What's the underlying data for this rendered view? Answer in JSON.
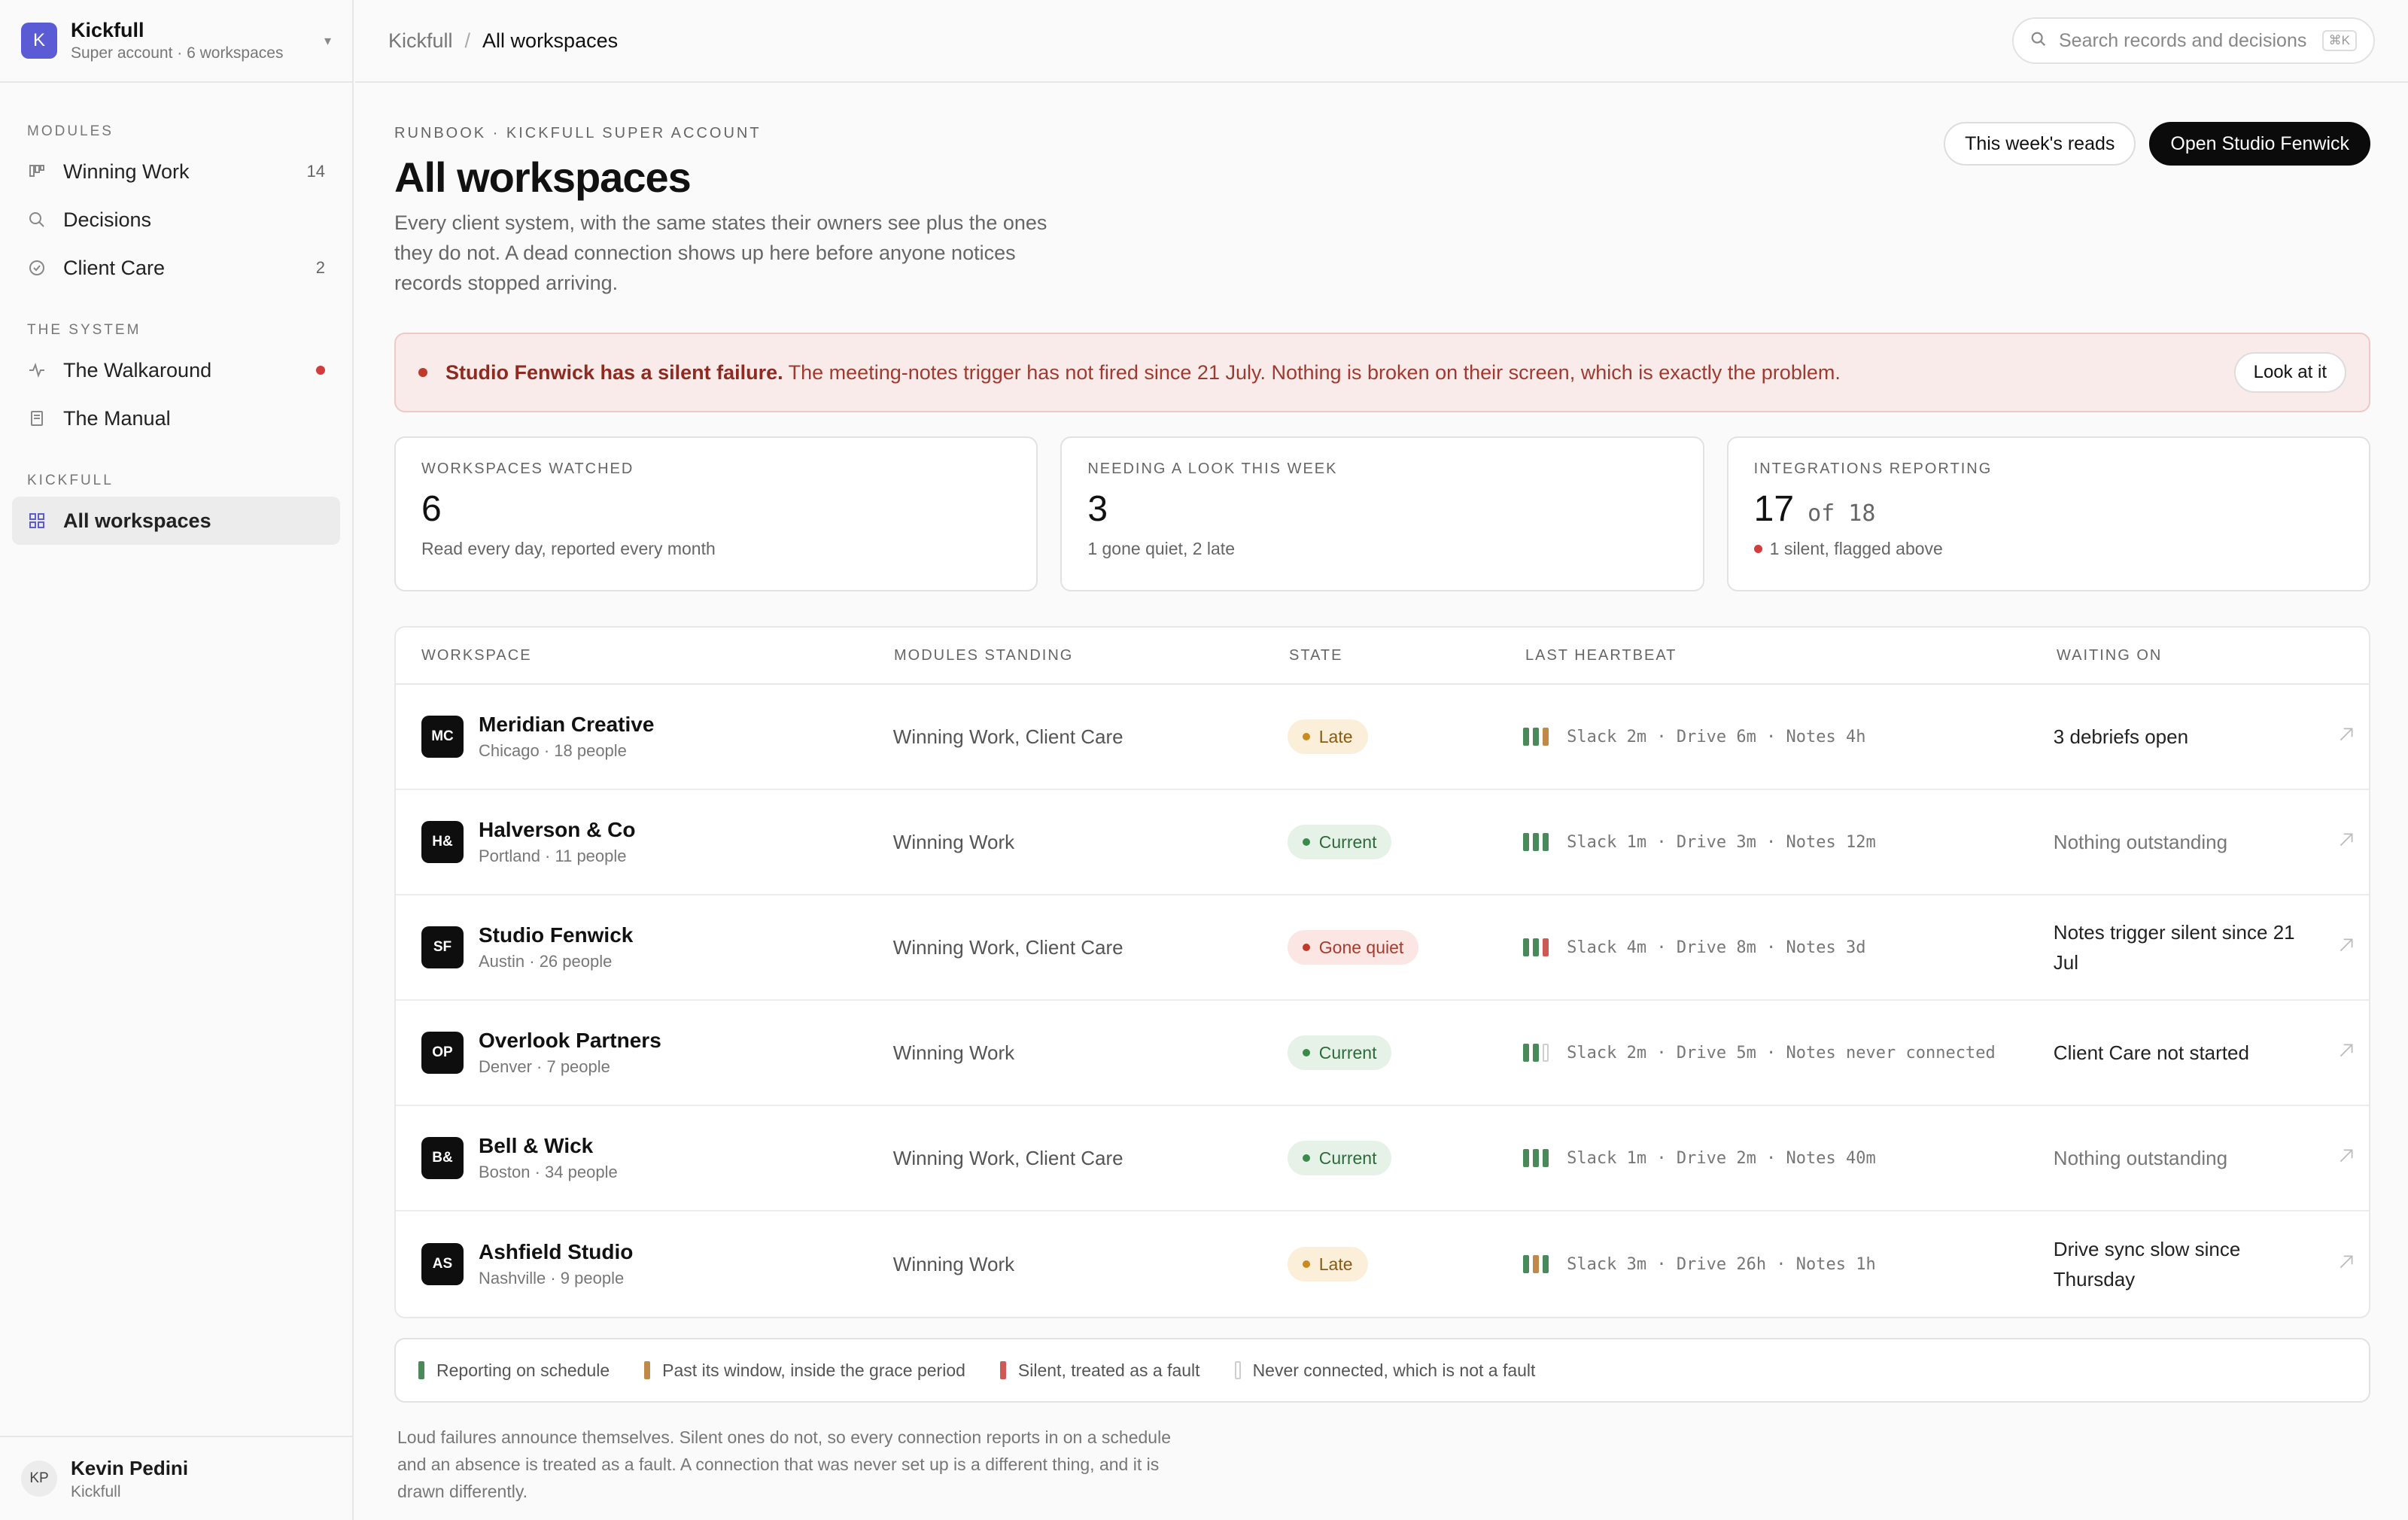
{
  "workspace": {
    "logo": "K",
    "name": "Kickfull",
    "subtitle": "Super account · 6 workspaces"
  },
  "sidebar": {
    "sections": [
      {
        "heading": "MODULES",
        "items": [
          {
            "label": "Winning Work",
            "icon": "kanban-icon",
            "count": "14"
          },
          {
            "label": "Decisions",
            "icon": "search-icon",
            "count": ""
          },
          {
            "label": "Client Care",
            "icon": "check-circle-icon",
            "count": "2"
          }
        ]
      },
      {
        "heading": "THE SYSTEM",
        "items": [
          {
            "label": "The Walkaround",
            "icon": "pulse-icon",
            "alert": true
          },
          {
            "label": "The Manual",
            "icon": "book-icon"
          }
        ]
      },
      {
        "heading": "KICKFULL",
        "items": [
          {
            "label": "All workspaces",
            "icon": "grid-icon",
            "active": true
          }
        ]
      }
    ]
  },
  "user": {
    "initials": "KP",
    "name": "Kevin Pedini",
    "org": "Kickfull"
  },
  "topbar": {
    "crumb_root": "Kickfull",
    "crumb_sep": "/",
    "crumb_current": "All workspaces",
    "search_placeholder": "Search records and decisions",
    "search_shortcut": "⌘K"
  },
  "header": {
    "eyebrow": "RUNBOOK · KICKFULL SUPER ACCOUNT",
    "title": "All workspaces",
    "description": "Every client system, with the same states their owners see plus the ones they do not. A dead connection shows up here before anyone notices records stopped arriving.",
    "secondary_action": "This week's reads",
    "primary_action": "Open Studio Fenwick"
  },
  "alert": {
    "strong": "Studio Fenwick has a silent failure.",
    "text": " The meeting-notes trigger has not fired since 21 July. Nothing is broken on their screen, which is exactly the problem.",
    "action": "Look at it"
  },
  "stats": [
    {
      "label": "WORKSPACES WATCHED",
      "value": "6",
      "of": "",
      "note": "Read every day, reported every month"
    },
    {
      "label": "NEEDING A LOOK THIS WEEK",
      "value": "3",
      "of": "",
      "note": "1 gone quiet, 2 late"
    },
    {
      "label": "INTEGRATIONS REPORTING",
      "value": "17",
      "of": " of 18",
      "note": "1 silent, flagged above"
    }
  ],
  "table": {
    "columns": [
      "WORKSPACE",
      "MODULES STANDING",
      "STATE",
      "LAST HEARTBEAT",
      "WAITING ON"
    ],
    "rows": [
      {
        "initials": "MC",
        "name": "Meridian Creative",
        "sub": "Chicago · 18 people",
        "modules": "Winning Work, Client Care",
        "state": "Late",
        "state_kind": "late",
        "bars": [
          "ok",
          "ok",
          "late"
        ],
        "heartbeat": "Slack 2m · Drive 6m · Notes 4h",
        "waiting": "3 debriefs open",
        "muted": false
      },
      {
        "initials": "H&",
        "name": "Halverson & Co",
        "sub": "Portland · 11 people",
        "modules": "Winning Work",
        "state": "Current",
        "state_kind": "current",
        "bars": [
          "ok",
          "ok",
          "ok"
        ],
        "heartbeat": "Slack 1m · Drive 3m · Notes 12m",
        "waiting": "Nothing outstanding",
        "muted": true
      },
      {
        "initials": "SF",
        "name": "Studio Fenwick",
        "sub": "Austin · 26 people",
        "modules": "Winning Work, Client Care",
        "state": "Gone quiet",
        "state_kind": "quiet",
        "bars": [
          "ok",
          "ok",
          "silent"
        ],
        "heartbeat": "Slack 4m · Drive 8m · Notes 3d",
        "waiting": "Notes trigger silent since 21 Jul",
        "muted": false
      },
      {
        "initials": "OP",
        "name": "Overlook Partners",
        "sub": "Denver · 7 people",
        "modules": "Winning Work",
        "state": "Current",
        "state_kind": "current",
        "bars": [
          "ok",
          "ok",
          "never"
        ],
        "heartbeat": "Slack 2m · Drive 5m · Notes never connected",
        "waiting": "Client Care not started",
        "muted": false
      },
      {
        "initials": "B&",
        "name": "Bell & Wick",
        "sub": "Boston · 34 people",
        "modules": "Winning Work, Client Care",
        "state": "Current",
        "state_kind": "current",
        "bars": [
          "ok",
          "ok",
          "ok"
        ],
        "heartbeat": "Slack 1m · Drive 2m · Notes 40m",
        "waiting": "Nothing outstanding",
        "muted": true
      },
      {
        "initials": "AS",
        "name": "Ashfield Studio",
        "sub": "Nashville · 9 people",
        "modules": "Winning Work",
        "state": "Late",
        "state_kind": "late",
        "bars": [
          "ok",
          "late",
          "ok"
        ],
        "heartbeat": "Slack 3m · Drive 26h · Notes 1h",
        "waiting": "Drive sync slow since Thursday",
        "muted": false
      }
    ]
  },
  "legend": [
    {
      "kind": "ok",
      "label": "Reporting on schedule"
    },
    {
      "kind": "late",
      "label": "Past its window, inside the grace period"
    },
    {
      "kind": "silent",
      "label": "Silent, treated as a fault"
    },
    {
      "kind": "never",
      "label": "Never connected, which is not a fault"
    }
  ],
  "footnote": "Loud failures announce themselves. Silent ones do not, so every connection reports in on a schedule and an absence is treated as a fault. A connection that was never set up is a different thing, and it is drawn differently."
}
